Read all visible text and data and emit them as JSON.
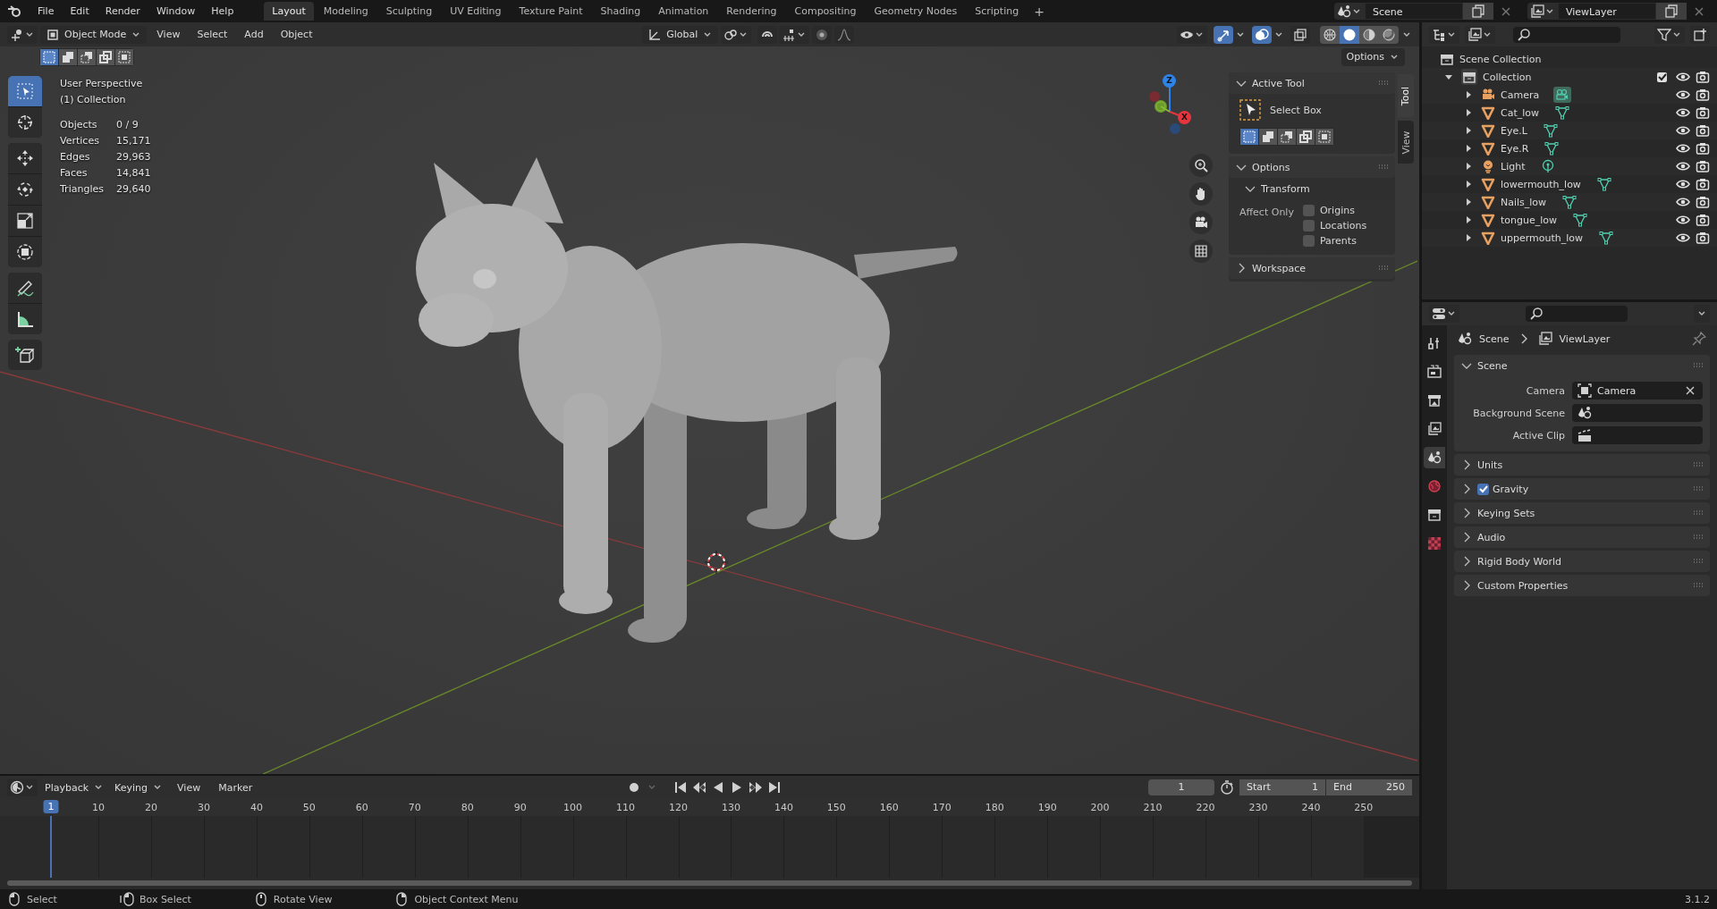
{
  "topbar": {
    "menus": [
      "File",
      "Edit",
      "Render",
      "Window",
      "Help"
    ],
    "workspaces": [
      {
        "label": "Layout",
        "selected": true
      },
      {
        "label": "Modeling",
        "selected": false
      },
      {
        "label": "Sculpting",
        "selected": false
      },
      {
        "label": "UV Editing",
        "selected": false
      },
      {
        "label": "Texture Paint",
        "selected": false
      },
      {
        "label": "Shading",
        "selected": false
      },
      {
        "label": "Animation",
        "selected": false
      },
      {
        "label": "Rendering",
        "selected": false
      },
      {
        "label": "Compositing",
        "selected": false
      },
      {
        "label": "Geometry Nodes",
        "selected": false
      },
      {
        "label": "Scripting",
        "selected": false
      }
    ],
    "add_workspace": "+",
    "scene": "Scene",
    "view_layer": "ViewLayer"
  },
  "viewport": {
    "mode": "Object Mode",
    "menus": [
      "View",
      "Select",
      "Add",
      "Object"
    ],
    "orientation": "Global",
    "snap_on": false,
    "toggles": [
      {
        "kind": "gizmo",
        "on": true
      },
      {
        "kind": "overlay",
        "on": true
      },
      {
        "kind": "xray",
        "on": false
      }
    ],
    "shading": [
      {
        "kind": "wireframe",
        "selected": false
      },
      {
        "kind": "solid",
        "selected": true
      },
      {
        "kind": "material",
        "selected": false
      },
      {
        "kind": "rendered",
        "selected": false
      }
    ],
    "select_modes": [
      {
        "kind": "set",
        "selected": true
      },
      {
        "kind": "extend",
        "selected": false
      },
      {
        "kind": "subtract",
        "selected": false
      },
      {
        "kind": "invert",
        "selected": false
      },
      {
        "kind": "intersect",
        "selected": false
      }
    ],
    "options": "Options",
    "tool_groups": [
      [
        {
          "kind": "select",
          "selected": true
        },
        {
          "kind": "cursor",
          "selected": false
        }
      ],
      [
        {
          "kind": "move",
          "selected": false
        },
        {
          "kind": "rotate",
          "selected": false
        },
        {
          "kind": "scale",
          "selected": false
        },
        {
          "kind": "transform",
          "selected": false
        }
      ],
      [
        {
          "kind": "annotate",
          "selected": false
        },
        {
          "kind": "measure",
          "selected": false
        }
      ],
      [
        {
          "kind": "add-cube",
          "selected": false
        }
      ]
    ],
    "view_name": "User Perspective",
    "collection": "(1) Collection",
    "stats": [
      {
        "label": "Objects",
        "value": "0 / 9"
      },
      {
        "label": "Vertices",
        "value": "15,171"
      },
      {
        "label": "Edges",
        "value": "29,963"
      },
      {
        "label": "Faces",
        "value": "14,841"
      },
      {
        "label": "Triangles",
        "value": "29,640"
      }
    ],
    "gizmo_axes": [
      {
        "label": "Z",
        "color": "#2f83e6"
      },
      {
        "label": "X",
        "color": "#e6353f"
      }
    ]
  },
  "side_panel": {
    "tabs": [
      {
        "label": "Tool",
        "selected": true
      },
      {
        "label": "View",
        "selected": false
      }
    ],
    "active_tool": {
      "title": "Active Tool",
      "expanded": true,
      "tool": "Select Box",
      "select_modes": [
        {
          "kind": "set",
          "selected": true
        },
        {
          "kind": "extend",
          "selected": false
        },
        {
          "kind": "subtract",
          "selected": false
        },
        {
          "kind": "invert",
          "selected": false
        },
        {
          "kind": "intersect",
          "selected": false
        }
      ]
    },
    "options": {
      "title": "Options",
      "expanded": true,
      "transform": "Transform",
      "transform_expanded": true,
      "affect_label": "Affect Only",
      "checks": [
        {
          "label": "Origins",
          "checked": false
        },
        {
          "label": "Locations",
          "checked": false
        },
        {
          "label": "Parents",
          "checked": false
        }
      ]
    },
    "workspace": {
      "title": "Workspace",
      "expanded": false
    }
  },
  "outliner": {
    "root": "Scene Collection",
    "collection": {
      "label": "Collection",
      "expanded": true,
      "checked": true,
      "children": [
        {
          "label": "Camera",
          "kind": "camera",
          "data_active": true
        },
        {
          "label": "Cat_low",
          "kind": "mesh",
          "data_active": false
        },
        {
          "label": "Eye.L",
          "kind": "mesh",
          "data_active": false
        },
        {
          "label": "Eye.R",
          "kind": "mesh",
          "data_active": false
        },
        {
          "label": "Light",
          "kind": "light",
          "data_active": false
        },
        {
          "label": "lowermouth_low",
          "kind": "mesh",
          "data_active": false
        },
        {
          "label": "Nails_low",
          "kind": "mesh",
          "data_active": false
        },
        {
          "label": "tongue_low",
          "kind": "mesh",
          "data_active": false
        },
        {
          "label": "uppermouth_low",
          "kind": "mesh",
          "data_active": false
        }
      ]
    }
  },
  "properties": {
    "tabs": [
      {
        "kind": "tool",
        "selected": false
      },
      {
        "kind": "render",
        "selected": false
      },
      {
        "kind": "output",
        "selected": false
      },
      {
        "kind": "view_layer",
        "selected": false
      },
      {
        "kind": "scene",
        "selected": true
      },
      {
        "kind": "world",
        "selected": false
      },
      {
        "kind": "collection",
        "selected": false
      },
      {
        "kind": "texture",
        "selected": false
      }
    ],
    "breadcrumb": [
      "Scene",
      "ViewLayer"
    ],
    "scene_panel": {
      "title": "Scene",
      "expanded": true,
      "fields": [
        {
          "label": "Camera",
          "kind": "camera",
          "value": "Camera"
        },
        {
          "label": "Background Scene",
          "kind": "scene"
        },
        {
          "label": "Active Clip",
          "kind": "clip"
        }
      ]
    },
    "panels": [
      {
        "title": "Units",
        "kind": "plain"
      },
      {
        "title": "Gravity",
        "kind": "checkbox",
        "checked": true
      },
      {
        "title": "Keying Sets",
        "kind": "plain"
      },
      {
        "title": "Audio",
        "kind": "plain"
      },
      {
        "title": "Rigid Body World",
        "kind": "plain"
      },
      {
        "title": "Custom Properties",
        "kind": "plain"
      }
    ]
  },
  "timeline": {
    "menus": [
      "Playback",
      "Keying"
    ],
    "plain_menus": [
      "View",
      "Marker"
    ],
    "current_frame": "1",
    "start_label": "Start",
    "start": "1",
    "end_label": "End",
    "end": "250",
    "playhead": "1",
    "ruler": [
      "10",
      "20",
      "30",
      "40",
      "50",
      "60",
      "70",
      "80",
      "90",
      "100",
      "110",
      "120",
      "130",
      "140",
      "150",
      "160",
      "170",
      "180",
      "190",
      "200",
      "210",
      "220",
      "230",
      "240",
      "250"
    ]
  },
  "status_bar": {
    "hints": [
      {
        "kind": "left",
        "label": "Select"
      },
      {
        "kind": "drag",
        "label": "Box Select"
      },
      {
        "kind": "middle",
        "label": "Rotate View"
      },
      {
        "kind": "right",
        "label": "Object Context Menu"
      }
    ],
    "version": "3.1.2"
  }
}
